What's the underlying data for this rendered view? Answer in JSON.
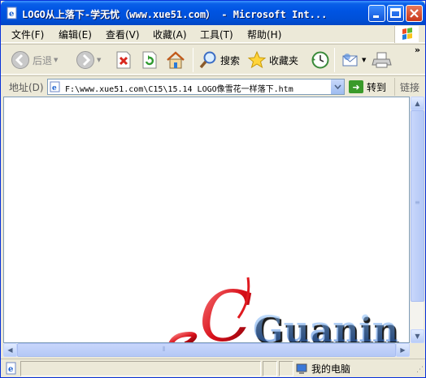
{
  "window": {
    "title": "LOGO从上落下-学无忧（www.xue51.com） - Microsoft Int...",
    "app_icon": "ie-page-icon",
    "controls": [
      "minimize",
      "maximize",
      "close"
    ]
  },
  "menu": [
    "文件(F)",
    "编辑(E)",
    "查看(V)",
    "收藏(A)",
    "工具(T)",
    "帮助(H)"
  ],
  "toolbar": {
    "back_label": "后退",
    "search_label": "搜索",
    "favorites_label": "收藏夹"
  },
  "address": {
    "label": "地址(D)",
    "url": "F:\\www.xue51.com\\C15\\15.14  LOGO像雪花一样落下.htm",
    "go_label": "转到",
    "links_label": "链接"
  },
  "content": {
    "logo_text": "Guanin",
    "logo_letter": "C"
  },
  "status": {
    "zone_label": "我的电脑"
  }
}
